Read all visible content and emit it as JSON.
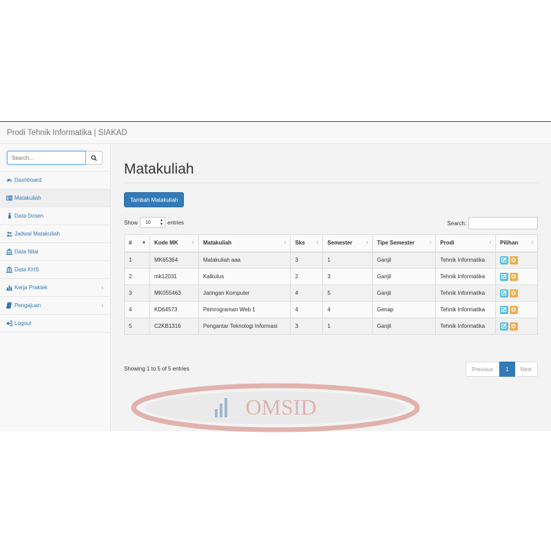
{
  "navbar": {
    "brand": "Prodi Tehnik Informatika | SIAKAD"
  },
  "sidebar": {
    "search_placeholder": "Search...",
    "items": [
      {
        "label": "Dashboard",
        "icon": "dashboard-icon"
      },
      {
        "label": "Matakuliah",
        "icon": "list-icon"
      },
      {
        "label": "Data Dosen",
        "icon": "person-icon"
      },
      {
        "label": "Jadwal Matakuliah",
        "icon": "users-icon"
      },
      {
        "label": "Data Nilai",
        "icon": "bank-icon"
      },
      {
        "label": "Data KHS",
        "icon": "bank-icon"
      },
      {
        "label": "Kerja Praktek",
        "icon": "bar-chart-icon"
      },
      {
        "label": "Pengajuan",
        "icon": "book-icon"
      },
      {
        "label": "Logout",
        "icon": "sign-out-icon"
      }
    ],
    "active_index": 1
  },
  "main": {
    "title": "Matakuliah",
    "add_button": "Tambah Matakuliah",
    "show_label": "Show",
    "entries_value": "10",
    "entries_label": "entries",
    "search_label": "Search:",
    "table": {
      "headers": [
        "#",
        "Kode MK",
        "Matakuliah",
        "Sks",
        "Semester",
        "Tipe Semester",
        "Prodi",
        "Pilihan"
      ],
      "rows": [
        [
          "1",
          "MK65364",
          "Matakuliah aaa",
          "3",
          "1",
          "Ganjil",
          "Tehnik Informatika"
        ],
        [
          "2",
          "mk12031",
          "Kalkulus",
          "2",
          "3",
          "Ganjil",
          "Tehnik Informatika"
        ],
        [
          "3",
          "MK055463",
          "Jaringan Komputer",
          "4",
          "5",
          "Ganjil",
          "Tehnik Informatika"
        ],
        [
          "4",
          "KD64573",
          "Pemrograman Web 1",
          "4",
          "4",
          "Genap",
          "Tehnik Informatika"
        ],
        [
          "5",
          "C2KB1316",
          "Pengantar Teknologi Informasi",
          "3",
          "1",
          "Ganjil",
          "Tehnik Informatika"
        ]
      ]
    },
    "info": "Showing 1 to 5 of 5 entries",
    "pagination": {
      "previous": "Previous",
      "current": "1",
      "next": "Next"
    }
  },
  "watermark": {
    "text": "OMSID"
  },
  "colors": {
    "primary": "#337ab7",
    "edit": "#5bc0de",
    "delete": "#f0ad4e"
  }
}
